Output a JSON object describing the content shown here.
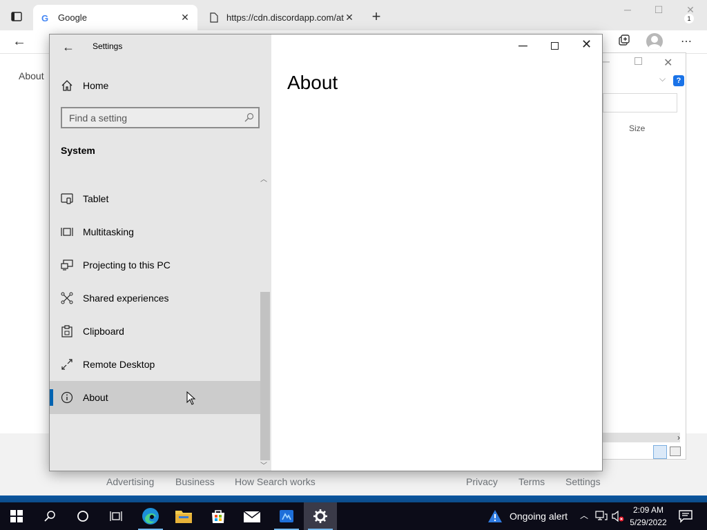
{
  "browser": {
    "tabs": [
      {
        "title": "Google",
        "icon": "google-g-icon",
        "active": true
      },
      {
        "title": "https://cdn.discordapp.com/attachments",
        "icon": "page-icon",
        "active": false
      }
    ],
    "page_about_link": "About",
    "footer_links": [
      "Advertising",
      "Business",
      "How Search works",
      "Privacy",
      "Terms",
      "Settings"
    ]
  },
  "file_dialog": {
    "column_header": "Size",
    "help_label": "?"
  },
  "settings": {
    "window_title": "Settings",
    "home_label": "Home",
    "search_placeholder": "Find a setting",
    "section": "System",
    "nav_items": [
      {
        "label": "Tablet",
        "icon": "tablet-icon"
      },
      {
        "label": "Multitasking",
        "icon": "multitasking-icon"
      },
      {
        "label": "Projecting to this PC",
        "icon": "projecting-icon"
      },
      {
        "label": "Shared experiences",
        "icon": "shared-experiences-icon"
      },
      {
        "label": "Clipboard",
        "icon": "clipboard-icon"
      },
      {
        "label": "Remote Desktop",
        "icon": "remote-desktop-icon"
      },
      {
        "label": "About",
        "icon": "info-icon",
        "selected": true
      }
    ],
    "page_title": "About",
    "accent_color": "#0063b1"
  },
  "taskbar": {
    "apps": [
      "start",
      "search",
      "cortana",
      "task-view",
      "edge",
      "file-explorer",
      "store",
      "mail",
      "network-tool",
      "settings"
    ],
    "alert_text": "Ongoing alert",
    "time": "2:09 AM",
    "date": "5/29/2022",
    "notification_count": "1"
  }
}
